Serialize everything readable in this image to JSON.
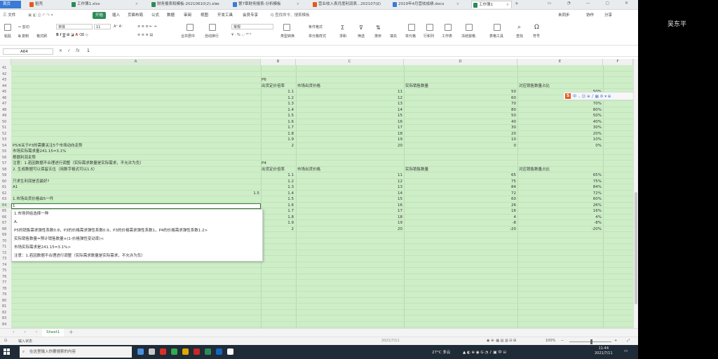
{
  "side_panel": {
    "user_name": "吴东平"
  },
  "tabs": [
    {
      "label": "首页",
      "color": "#3a7bd5"
    },
    {
      "label": "稻壳",
      "color": "#e35a1c"
    },
    {
      "label": "工作簿1.xlsx",
      "color": "#2e8b57"
    },
    {
      "label": "财务报表和模板-20210610(2).xlsx",
      "color": "#2e8b57"
    },
    {
      "label": "第7章财务报表-分析模板",
      "color": "#3a7bd5"
    },
    {
      "label": "营业收入表月度利润表...202107(2)",
      "color": "#e35a1c"
    },
    {
      "label": "2019年4月营收成绩.docx",
      "color": "#3a7bd5"
    },
    {
      "label": "工作簿1",
      "color": "#2e8b57"
    }
  ],
  "menu": {
    "file": "三 文件",
    "items": [
      "开始",
      "插入",
      "页面布局",
      "公式",
      "数据",
      "审阅",
      "视图",
      "开发工具",
      "会员专享",
      "Q 查找命令、搜索模板"
    ],
    "right": [
      "未同步",
      "协作",
      "分享"
    ]
  },
  "ribbon": {
    "paste": "粘贴",
    "cut": "剪切",
    "copy": "复制",
    "format_painter": "格式刷",
    "font_name": "宋体",
    "font_size": "11",
    "merge_center": "合并居中",
    "wrap": "自动换行",
    "number_format": "常规",
    "convert": "类型转换",
    "cond_format": "条件格式",
    "cell_style": "单元格样式",
    "table_style": "表格样式",
    "sum": "求和",
    "filter": "筛选",
    "sort": "排序",
    "fill": "填充",
    "cells": "单元格",
    "rowcol": "行和列",
    "worksheet": "工作表",
    "freeze": "冻结窗格",
    "table_tools": "表格工具",
    "find": "查找",
    "symbol": "符号"
  },
  "formula_bar": {
    "name_box": "A64",
    "value": "1"
  },
  "columns": [
    "A",
    "B",
    "C",
    "D",
    "E",
    "F"
  ],
  "rows": [
    "41",
    "42",
    "43",
    "44",
    "45",
    "46",
    "47",
    "48",
    "49",
    "50",
    "51",
    "52",
    "53",
    "54",
    "55",
    "56",
    "57",
    "58",
    "59",
    "60",
    "61",
    "62",
    "63",
    "64",
    "65",
    "66",
    "67",
    "68",
    "69",
    "70",
    "71",
    "72",
    "73",
    "74",
    "75",
    "76",
    "77",
    "78",
    "79",
    "80",
    "81",
    "82",
    "83",
    "84"
  ],
  "table1": {
    "caption": "P6",
    "headers": [
      "出货定价倍率",
      "市场出货价格",
      "实际销售数量",
      "对应销售数量占比"
    ],
    "rows": [
      [
        "1.1",
        "11",
        "50",
        "50%"
      ],
      [
        "1.2",
        "12",
        "60",
        "60%"
      ],
      [
        "1.3",
        "13",
        "70",
        "70%"
      ],
      [
        "1.4",
        "14",
        "80",
        "80%"
      ],
      [
        "1.5",
        "15",
        "50",
        "50%"
      ],
      [
        "1.6",
        "16",
        "40",
        "40%"
      ],
      [
        "1.7",
        "17",
        "30",
        "30%"
      ],
      [
        "1.8",
        "18",
        "20",
        "20%"
      ],
      [
        "1.9",
        "19",
        "10",
        "10%"
      ],
      [
        "2",
        "20",
        "0",
        "0%"
      ]
    ]
  },
  "notes1": [
    "P5/6关于P3的需要关注5个市场动向走势",
    "市场实际需求量241.15=3.1%",
    "根据利润走势",
    "注意：1.若因数据不合理进行调整（实际需求数量是实际需求，不允许为负）",
    "2. 生成数据可以保留五位（用数字格式可以1.5）"
  ],
  "table2": {
    "caption": "P4",
    "headers": [
      "出货定价倍率",
      "市场出货价格",
      "实际销售数量",
      "对应销售数量占比"
    ],
    "rows": [
      [
        "1.1",
        "11",
        "65",
        "65%"
      ],
      [
        "1.2",
        "12",
        "75",
        "75%"
      ],
      [
        "1.3",
        "13",
        "84",
        "84%"
      ],
      [
        "1.4",
        "14",
        "72",
        "72%"
      ],
      [
        "1.5",
        "15",
        "60",
        "60%"
      ],
      [
        "1.6",
        "16",
        "26",
        "26%"
      ],
      [
        "1.7",
        "17",
        "16",
        "16%"
      ],
      [
        "1.8",
        "18",
        "4",
        "4%"
      ],
      [
        "1.9",
        "19",
        "-8",
        "-8%"
      ],
      [
        "2",
        "20",
        "-20",
        "-20%"
      ]
    ]
  },
  "notes2": [
    "只求生利润是否最好?",
    "A1",
    "1.市场出货价格由5一件"
  ],
  "b62_extra": "1.5",
  "editing_cell": {
    "value": "1"
  },
  "dropdown": [
    "1.市场供给选择一种",
    "A.",
    "P5的销售需求弹性系数0.8，P3的价格需求弹性系数0.9，P3的价格需求弹性系数1，P4的价格需求弹性系数1.2>",
    "实际销售数量=预计销售数量×(1-价格弹性变动率)<",
    "市场实际需求是241.15=3.1%>",
    "注意：1.若因数据不合理进行调整（实际需求数量是实际需求，不允许为负）"
  ],
  "ime": {
    "logo": "S",
    "glyphs": "中 ·, ☺ ⊕ ♪ ▦ ⚙ ▾ ⊞"
  },
  "sheet_tab": "Sheet1",
  "status": {
    "left": "输入状态",
    "middle": "2021/7/11",
    "zoom": "100%"
  },
  "taskbar": {
    "search_placeholder": "在这里输入你要搜索的内容",
    "weather": "27°C 多云",
    "time": "11:44",
    "date": "2021/7/11"
  }
}
